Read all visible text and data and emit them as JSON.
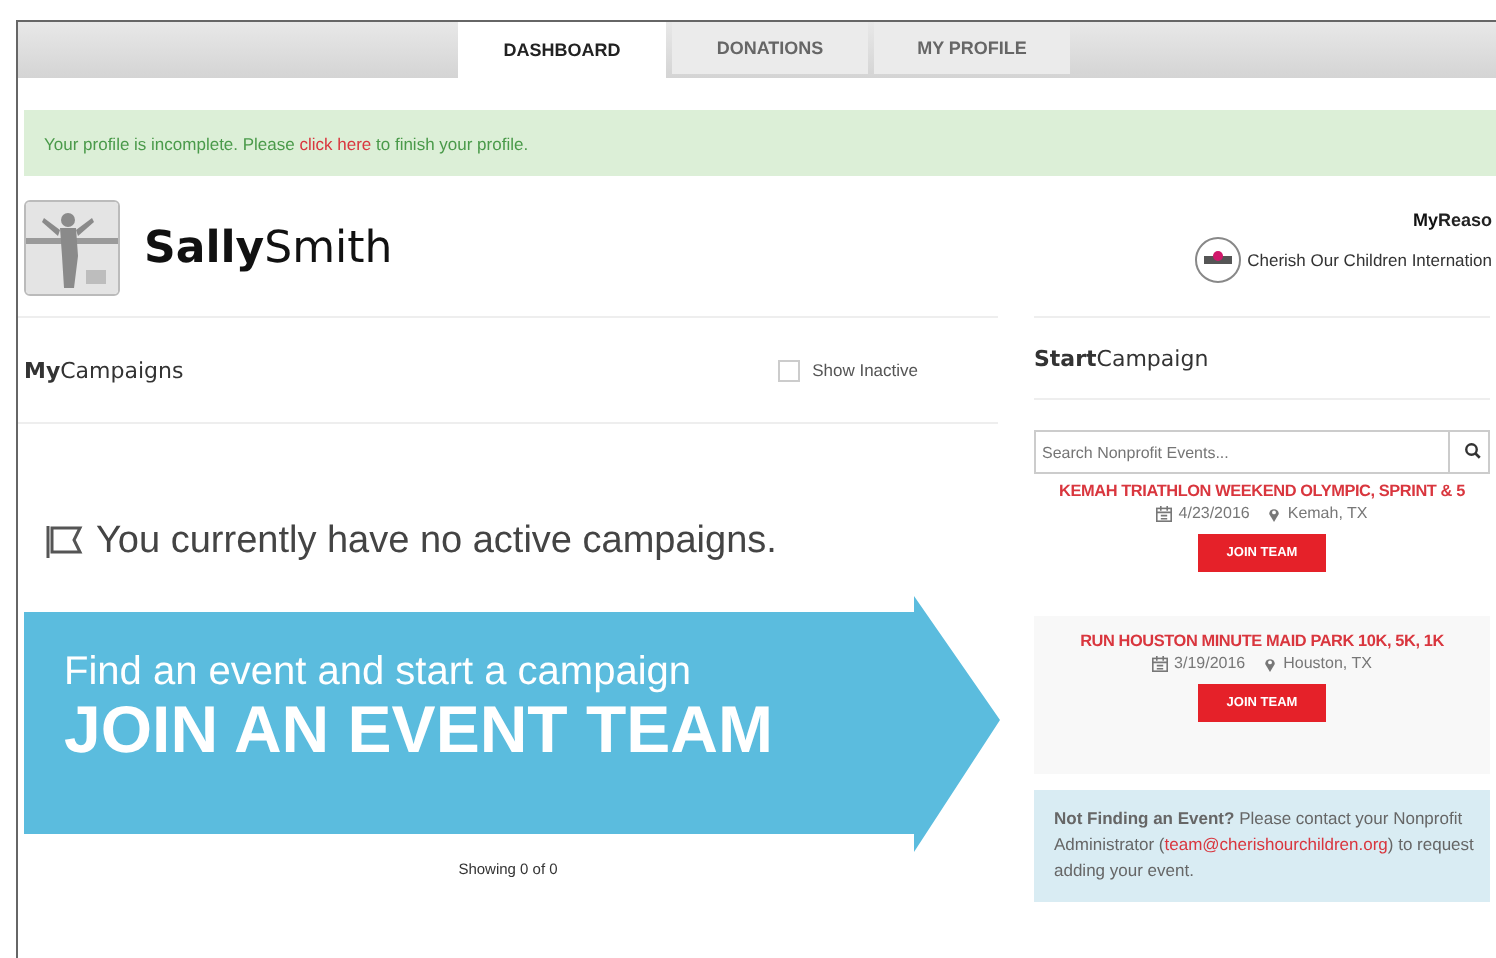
{
  "tabs": [
    {
      "label": "DASHBOARD",
      "selected": true
    },
    {
      "label": "DONATIONS",
      "selected": false
    },
    {
      "label": "MY PROFILE",
      "selected": false
    }
  ],
  "alert": {
    "before": "Your profile is incomplete. Please",
    "link": "click here",
    "after": "to finish your profile."
  },
  "profile": {
    "name": "**Sally**Smith",
    "reason_heading": "**My**Reaso",
    "organization": "Cherish Our Children Internation"
  },
  "campaigns": {
    "heading": "**My**Campaigns",
    "show_inactive": {
      "label": "Show Inactive",
      "checked": false
    },
    "empty_message": "You currently have no active campaigns.",
    "banner": {
      "line_1": "Find an event and start a campaign",
      "line_2": "JOIN AN EVENT TEAM"
    },
    "showing": "Showing 0 of 0"
  },
  "start_campaign": {
    "heading": "**Start**Campaign",
    "search": {
      "placeholder": "Search Nonprofit Events..."
    },
    "events": [
      {
        "title": "KEMAH TRIATHLON WEEKEND OLYMPIC, SPRINT & 5",
        "date": "4/23/2016",
        "location": "Kemah, TX",
        "button": "JOIN TEAM"
      },
      {
        "title": "RUN HOUSTON MINUTE MAID PARK 10K, 5K, 1K",
        "date": "3/19/2016",
        "location": "Houston, TX",
        "button": "JOIN TEAM"
      }
    ],
    "notice": {
      "before": "**Not Finding an Event?** Please contact your Nonprofit Administrator (",
      "link": "team@cherishourchildren.org",
      "after": ") to request adding your event."
    }
  }
}
